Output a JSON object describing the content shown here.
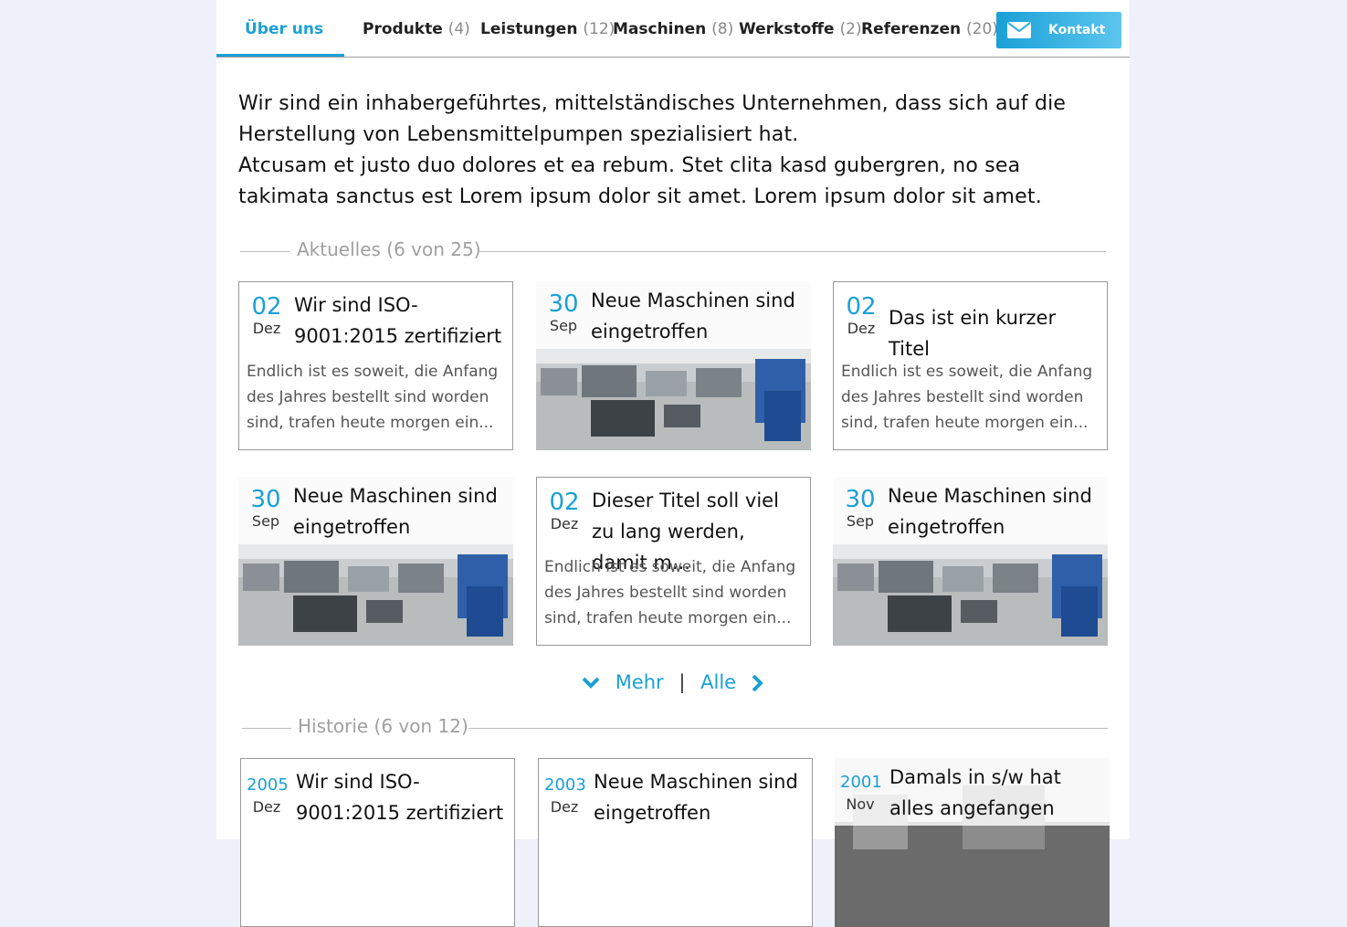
{
  "tabs": [
    {
      "label": "Über uns",
      "count": ""
    },
    {
      "label": "Produkte",
      "count": "(4)"
    },
    {
      "label": "Leistungen",
      "count": "(12)"
    },
    {
      "label": "Maschinen",
      "count": "(8)"
    },
    {
      "label": "Werkstoffe",
      "count": "(2)"
    },
    {
      "label": "Referenzen",
      "count": "(20)"
    }
  ],
  "contact": {
    "label": "Kontakt",
    "icon": "envelope-icon"
  },
  "intro": {
    "line1": "Wir sind ein inhabergeführtes, mittelständisches Unternehmen, dass sich auf die Herstellung von Lebensmittelpumpen spezialisiert hat.",
    "line2": "Atcusam et justo duo dolores et ea rebum. Stet clita kasd gubergren, no sea takimata sanctus est Lorem ipsum dolor sit amet. Lorem ipsum dolor sit amet."
  },
  "news": {
    "heading": "Aktuelles (6 von 25)",
    "cards": [
      {
        "day": "02",
        "month": "Dez",
        "title": "Wir sind ISO-9001:2015 zertifiziert",
        "excerpt": "Endlich ist es soweit, die Anfang des Jahres bestellt sind worden sind, trafen heute morgen ein..."
      },
      {
        "day": "30",
        "month": "Sep",
        "title": "Neue Maschinen sind eingetroffen",
        "excerpt": ""
      },
      {
        "day": "02",
        "month": "Dez",
        "title": "Das ist ein kurzer Titel",
        "excerpt": "Endlich ist es soweit, die Anfang des Jahres bestellt sind worden sind, trafen heute morgen ein..."
      },
      {
        "day": "30",
        "month": "Sep",
        "title": "Neue Maschinen sind eingetroffen",
        "excerpt": ""
      },
      {
        "day": "02",
        "month": "Dez",
        "title": "Dieser Titel soll viel zu lang werden, damit m...",
        "excerpt": "Endlich ist es soweit, die Anfang des Jahres bestellt sind worden sind, trafen heute morgen ein..."
      },
      {
        "day": "30",
        "month": "Sep",
        "title": "Neue Maschinen sind eingetroffen",
        "excerpt": ""
      }
    ],
    "more_label": "Mehr",
    "all_label": "Alle",
    "separator": "|"
  },
  "history": {
    "heading": "Historie (6 von 12)",
    "cards": [
      {
        "day": "2005",
        "month": "Dez",
        "title": "Wir sind ISO-9001:2015 zertifiziert"
      },
      {
        "day": "2003",
        "month": "Dez",
        "title": "Neue Maschinen sind eingetroffen"
      },
      {
        "day": "2001",
        "month": "Nov",
        "title": "Damals in s/w hat alles angefangen"
      }
    ]
  },
  "colors": {
    "accent": "#1aa0d6",
    "background": "#eef0fa"
  }
}
